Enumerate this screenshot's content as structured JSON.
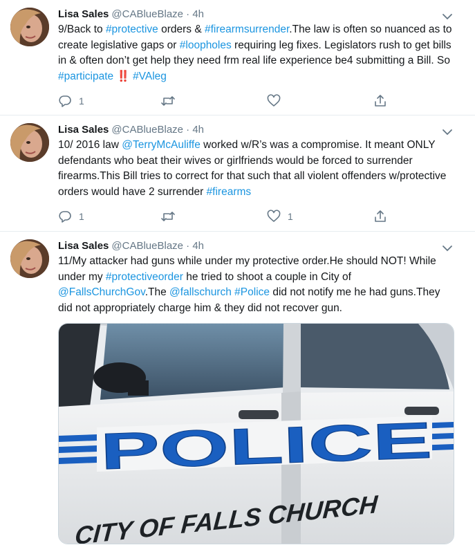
{
  "tweets": [
    {
      "name": "Lisa Sales",
      "handle": "@CABlueBlaze",
      "dot": "·",
      "time": "4h",
      "segments": [
        {
          "t": "9/Back to "
        },
        {
          "t": "#protective",
          "k": "hash"
        },
        {
          "t": " orders & "
        },
        {
          "t": "#firearmsurrender",
          "k": "hash"
        },
        {
          "t": ".The law is often so nuanced as to create legislative gaps or "
        },
        {
          "t": "#loopholes",
          "k": "hash"
        },
        {
          "t": " requiring leg fixes. Legislators rush to get bills in & often don’t get help they need frm real life experience be4 submitting a Bill.  So "
        },
        {
          "t": "#participate",
          "k": "hash"
        },
        {
          "t": " ‼️ ",
          "k": "emoji"
        },
        {
          "t": "#VAleg",
          "k": "hash"
        }
      ],
      "reply_count": "1",
      "retweet_count": "",
      "like_count": ""
    },
    {
      "name": "Lisa Sales",
      "handle": "@CABlueBlaze",
      "dot": "·",
      "time": "4h",
      "segments": [
        {
          "t": "10/ 2016 law "
        },
        {
          "t": "@TerryMcAuliffe",
          "k": "ment"
        },
        {
          "t": " worked w/R’s was a compromise. It meant ONLY defendants who beat their wives or girlfriends would be forced to surrender firearms.This Bill tries to correct for that such that all violent offenders w/protective orders would have 2 surrender "
        },
        {
          "t": "#firearms",
          "k": "hash"
        }
      ],
      "reply_count": "1",
      "retweet_count": "",
      "like_count": "1"
    },
    {
      "name": "Lisa Sales",
      "handle": "@CABlueBlaze",
      "dot": "·",
      "time": "4h",
      "segments": [
        {
          "t": "11/My attacker had guns while under my protective order.He should NOT! While under my "
        },
        {
          "t": "#protectiveorder",
          "k": "hash"
        },
        {
          "t": " he tried to shoot a couple in City of "
        },
        {
          "t": "@FallsChurchGov",
          "k": "ment"
        },
        {
          "t": ".The "
        },
        {
          "t": "@fallschurch",
          "k": "ment"
        },
        {
          "t": " "
        },
        {
          "t": "#Police",
          "k": "hash"
        },
        {
          "t": " did not notify me he had guns.They did not appropriately charge him & they did not recover gun."
        }
      ]
    }
  ],
  "media": {
    "door_text": "POLICE",
    "city_text": "CITY OF FALLS  CHURCH"
  },
  "colors": {
    "link": "#1b95e0",
    "muted": "#657786",
    "police_blue": "#1a5fc0"
  }
}
